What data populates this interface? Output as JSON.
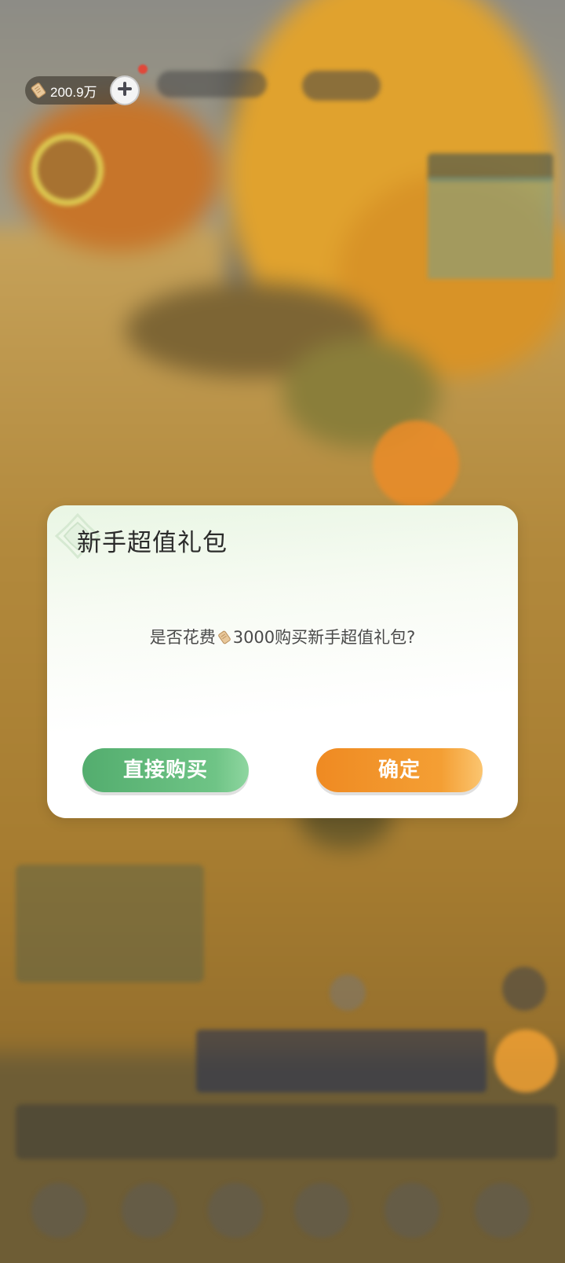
{
  "hud": {
    "currency": {
      "icon": "scroll-coin-icon",
      "value": "200.9万"
    },
    "add_button_icon": "plus-icon"
  },
  "dialog": {
    "title": "新手超值礼包",
    "message_prefix": "是否花费",
    "message_coin_icon": "scroll-coin-icon",
    "message_suffix": "3000购买新手超值礼包?",
    "buttons": {
      "direct_buy": "直接购买",
      "confirm": "确定"
    }
  },
  "colors": {
    "confirm_orange": "#F49A2E",
    "direct_buy_green": "#5DB676",
    "title_text": "#2B2B2B"
  }
}
